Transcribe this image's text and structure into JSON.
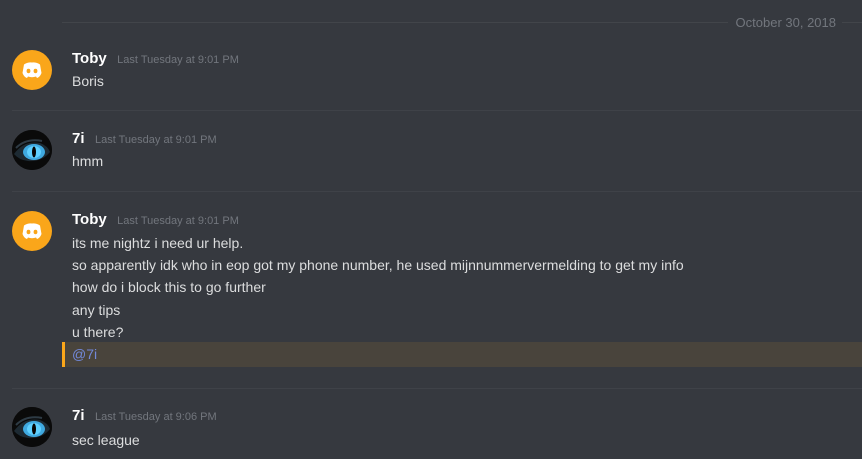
{
  "date_divider": "October 30, 2018",
  "messages": [
    {
      "author": "Toby",
      "timestamp": "Last Tuesday at 9:01 PM",
      "avatar": "discord-logo-icon",
      "lines": [
        "Boris"
      ]
    },
    {
      "author": "7i",
      "timestamp": "Last Tuesday at 9:01 PM",
      "avatar": "blue-eye-avatar",
      "lines": [
        "hmm"
      ]
    },
    {
      "author": "Toby",
      "timestamp": "Last Tuesday at 9:01 PM",
      "avatar": "discord-logo-icon",
      "lines": [
        "its me nightz i need ur help.",
        "so apparently idk who in eop got my phone number, he used mijnnummervermelding to get my info",
        "how do i block this to go further",
        "any tips",
        "u there?"
      ],
      "mention": "@7i"
    },
    {
      "author": "7i",
      "timestamp": "Last Tuesday at 9:06 PM",
      "avatar": "blue-eye-avatar",
      "lines": [
        "sec league"
      ]
    }
  ],
  "colors": {
    "background": "#36393f",
    "mention_highlight": "#49443c",
    "mention_bar": "#faa61a",
    "mention_text": "#7289da",
    "discord_avatar": "#faa61a"
  }
}
